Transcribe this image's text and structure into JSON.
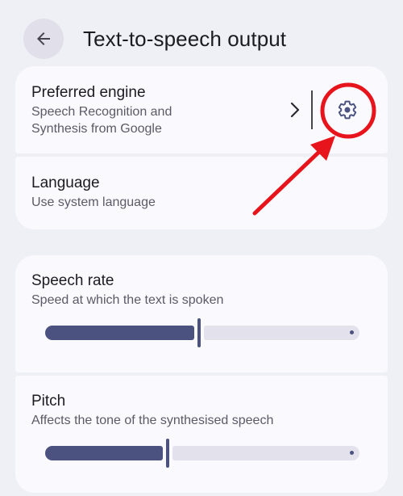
{
  "header": {
    "title": "Text-to-speech output",
    "back_icon": "arrow-back-icon"
  },
  "engine": {
    "title": "Preferred engine",
    "subtitle_line1": "Speech Recognition and",
    "subtitle_line2": "Synthesis from Google",
    "chevron_icon": "chevron-right-icon",
    "settings_icon": "gear-icon"
  },
  "language": {
    "title": "Language",
    "subtitle": "Use system language"
  },
  "speech_rate": {
    "title": "Speech rate",
    "subtitle": "Speed at which the text is spoken",
    "value_fraction": 0.49
  },
  "pitch": {
    "title": "Pitch",
    "subtitle": "Affects the tone of the synthesised speech",
    "value_fraction": 0.39
  },
  "colors": {
    "background": "#efeff6",
    "card": "#faf9fe",
    "accent": "#4b5280",
    "annotation_red": "#e8141c"
  }
}
